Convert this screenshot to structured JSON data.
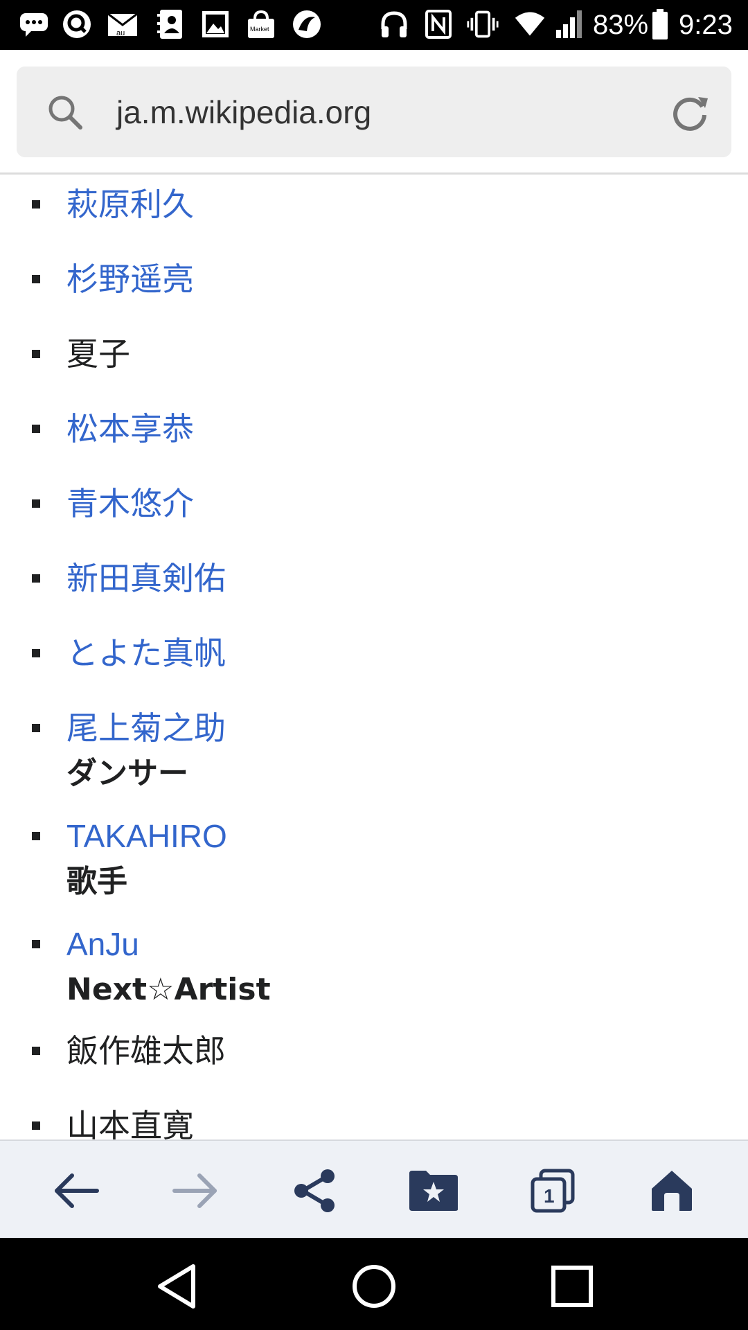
{
  "status_bar": {
    "battery_percent": "83%",
    "time": "9:23",
    "left_icons": [
      "chat-bubble-icon",
      "quick-search-icon",
      "au-mail-icon",
      "contacts-icon",
      "gallery-icon",
      "market-icon",
      "moon-app-icon"
    ],
    "right_icons": [
      "headphones-icon",
      "nfc-icon",
      "vibrate-icon",
      "wifi-icon",
      "signal-icon",
      "battery-icon"
    ],
    "market_icon_label": "Market",
    "au_label": "au"
  },
  "address_bar": {
    "url": "ja.m.wikipedia.org"
  },
  "list": {
    "items": [
      {
        "text": "萩原利久",
        "link": true
      },
      {
        "text": "杉野遥亮",
        "link": true
      },
      {
        "text": "夏子",
        "link": false
      },
      {
        "text": "松本享恭",
        "link": true
      },
      {
        "text": "青木悠介",
        "link": true
      },
      {
        "text": "新田真剣佑",
        "link": true
      },
      {
        "text": "とよた真帆",
        "link": true
      },
      {
        "text": "尾上菊之助",
        "link": true
      },
      {
        "text": "TAKAHIRO",
        "link": true
      },
      {
        "text": "AnJu",
        "link": true
      },
      {
        "text": "飯作雄太郎",
        "link": false
      },
      {
        "text": "山本直寛",
        "link": false
      }
    ],
    "sub_labels": {
      "dancer": "ダンサー",
      "singer": "歌手",
      "next_artist": "Next☆Artist"
    }
  },
  "bottom_toolbar": {
    "buttons": [
      "back-icon",
      "forward-icon",
      "share-icon",
      "bookmarks-icon",
      "tabs-icon",
      "home-icon"
    ],
    "tab_count": "1"
  },
  "nav_bar": {
    "buttons": [
      "nav-back-icon",
      "nav-home-icon",
      "nav-recents-icon"
    ]
  },
  "colors": {
    "link": "#3366cc",
    "text": "#202122",
    "toolbar_icon": "#2a3a5c",
    "toolbar_icon_disabled": "#9aa3b5"
  }
}
